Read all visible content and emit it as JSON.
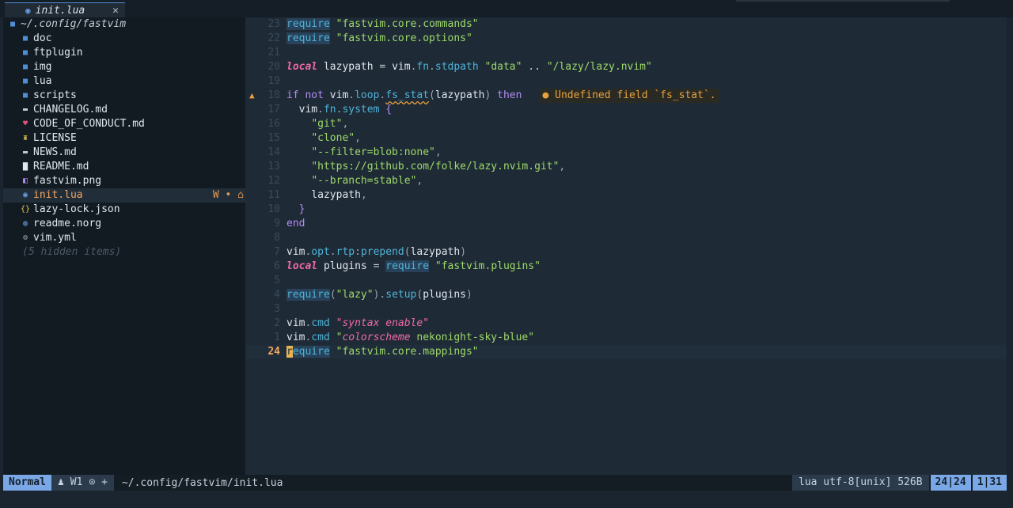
{
  "tab": {
    "icon": "lua-icon",
    "name": "init.lua",
    "close": "✕"
  },
  "tree": {
    "root": "~/.config/fastvim",
    "items": [
      {
        "name": "doc",
        "kind": "folder"
      },
      {
        "name": "ftplugin",
        "kind": "folder"
      },
      {
        "name": "img",
        "kind": "folder"
      },
      {
        "name": "lua",
        "kind": "folder"
      },
      {
        "name": "scripts",
        "kind": "folder"
      },
      {
        "name": "CHANGELOG.md",
        "kind": "markdown"
      },
      {
        "name": "CODE_OF_CONDUCT.md",
        "kind": "markdown-heart"
      },
      {
        "name": "LICENSE",
        "kind": "license"
      },
      {
        "name": "NEWS.md",
        "kind": "markdown"
      },
      {
        "name": "README.md",
        "kind": "readme"
      },
      {
        "name": "fastvim.png",
        "kind": "image"
      },
      {
        "name": "init.lua",
        "kind": "lua",
        "selected": true,
        "flags": "W • ⌂"
      },
      {
        "name": "lazy-lock.json",
        "kind": "json"
      },
      {
        "name": "readme.norg",
        "kind": "norg"
      },
      {
        "name": "vim.yml",
        "kind": "yaml"
      }
    ],
    "hidden": "(5 hidden items)"
  },
  "lines": [
    {
      "n": "23",
      "html": "<span class='fn-req'>require</span> <span class='str'>\"fastvim.core.commands\"</span>"
    },
    {
      "n": "22",
      "html": "<span class='fn-req'>require</span> <span class='str'>\"fastvim.core.options\"</span>"
    },
    {
      "n": "21",
      "html": ""
    },
    {
      "n": "20",
      "html": "<span class='kw-local'>local</span> <span class='var'>lazypath</span> <span class='op'>=</span> <span class='var'>vim</span><span class='punct'>.</span><span class='field'>fn</span><span class='punct'>.</span><span class='field'>stdpath</span> <span class='str'>\"data\"</span> <span class='op'>..</span> <span class='str'>\"/lazy/lazy.nvim\"</span>"
    },
    {
      "n": "19",
      "html": ""
    },
    {
      "n": "18",
      "sign": "▲",
      "html": "<span class='kw-flow'>if</span> <span class='kw-flow'>not</span> <span class='var'>vim</span><span class='punct'>.</span><span class='field'>loop</span><span class='punct'>.</span><span class='field warn-underline'>fs_stat</span><span class='punct'>(</span><span class='var'>lazypath</span><span class='punct'>)</span> <span class='kw-flow'>then</span>",
      "diag": "● Undefined field `fs_stat`."
    },
    {
      "n": "17",
      "html": "  <span class='var'>vim</span><span class='punct'>.</span><span class='field'>fn</span><span class='punct'>.</span><span class='field'>system</span> <span class='brace'>{</span>"
    },
    {
      "n": "16",
      "html": "    <span class='str'>\"git\"</span><span class='punct'>,</span>"
    },
    {
      "n": "15",
      "html": "    <span class='str'>\"clone\"</span><span class='punct'>,</span>"
    },
    {
      "n": "14",
      "html": "    <span class='str'>\"--filter=blob:none\"</span><span class='punct'>,</span>"
    },
    {
      "n": "13",
      "html": "    <span class='str'>\"https://github.com/folke/lazy.nvim.git\"</span><span class='punct'>,</span>"
    },
    {
      "n": "12",
      "html": "    <span class='str'>\"--branch=stable\"</span><span class='punct'>,</span>"
    },
    {
      "n": "11",
      "html": "    <span class='var'>lazypath</span><span class='punct'>,</span>"
    },
    {
      "n": "10",
      "html": "  <span class='brace'>}</span>"
    },
    {
      "n": "9",
      "html": "<span class='kw-flow'>end</span>"
    },
    {
      "n": "8",
      "html": ""
    },
    {
      "n": "7",
      "html": "<span class='var'>vim</span><span class='punct'>.</span><span class='field'>opt</span><span class='punct'>.</span><span class='field'>rtp</span><span class='punct'>:</span><span class='field'>prepend</span><span class='punct'>(</span><span class='var'>lazypath</span><span class='punct'>)</span>"
    },
    {
      "n": "6",
      "html": "<span class='kw-local'>local</span> <span class='var'>plugins</span> <span class='op'>=</span> <span class='fn-req'>require</span> <span class='str'>\"fastvim.plugins\"</span>"
    },
    {
      "n": "5",
      "html": ""
    },
    {
      "n": "4",
      "html": "<span class='fn-req'>require</span><span class='punct'>(</span><span class='str'>\"lazy\"</span><span class='punct'>).</span><span class='field'>setup</span><span class='punct'>(</span><span class='var'>plugins</span><span class='punct'>)</span>"
    },
    {
      "n": "3",
      "html": ""
    },
    {
      "n": "2",
      "html": "<span class='var'>vim</span><span class='punct'>.</span><span class='field'>cmd</span> <span class='str-it'>\"syntax enable\"</span>"
    },
    {
      "n": "1",
      "html": "<span class='var'>vim</span><span class='punct'>.</span><span class='field'>cmd</span> <span class='str'>\"</span><span class='str-it'>colorscheme</span> <span class='str'>nekonight-sky-blue\"</span>"
    },
    {
      "n": "24",
      "current": true,
      "html": "<span class='fn-req'><span class='cursor'>r</span>equire</span> <span class='str'>\"fastvim.core.mappings\"</span>"
    }
  ],
  "status": {
    "mode": "Normal",
    "seg2_icon": "♟",
    "window": "W1",
    "seg2_extra": "⊙ +",
    "path": "~/.config/fastvim/init.lua",
    "fileinfo": " lua utf-8[unix] 526B",
    "line_pos": "24|24",
    "col_pos": "1|31"
  },
  "colors": {
    "accent": "#7aa7e6",
    "warning": "#e7a23e",
    "string": "#9ed96a",
    "keyword": "#f06aa8"
  }
}
